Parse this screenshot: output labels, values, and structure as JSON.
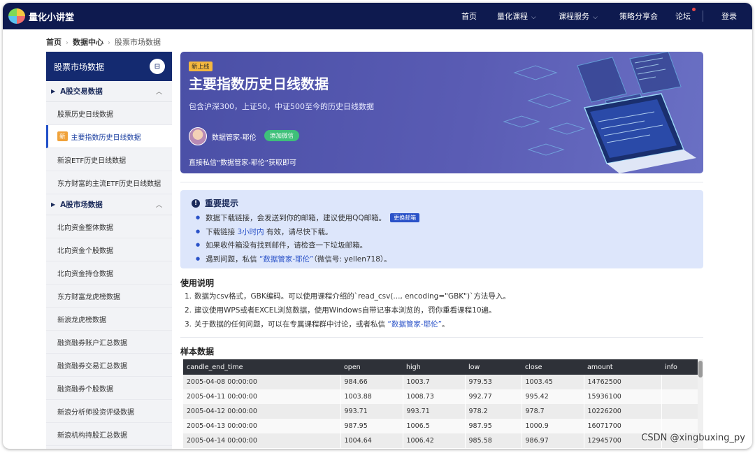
{
  "header": {
    "brand": "量化小讲堂",
    "nav": [
      {
        "label": "首页",
        "dropdown": false
      },
      {
        "label": "量化课程",
        "dropdown": true
      },
      {
        "label": "课程服务",
        "dropdown": true
      },
      {
        "label": "策略分享会",
        "dropdown": false
      },
      {
        "label": "论坛",
        "dropdown": false
      }
    ],
    "login": "登录"
  },
  "breadcrumb": [
    "首页",
    "数据中心",
    "股票市场数据"
  ],
  "sidebar": {
    "title": "股票市场数据",
    "groups": [
      {
        "label": "A股交易数据",
        "items": [
          {
            "label": "股票历史日线数据",
            "active": false,
            "new": false
          },
          {
            "label": "主要指数历史日线数据",
            "active": true,
            "new": true,
            "new_label": "新"
          },
          {
            "label": "新浪ETF历史日线数据",
            "active": false,
            "new": false
          },
          {
            "label": "东方财富的主流ETF历史日线数据",
            "active": false,
            "new": false
          }
        ]
      },
      {
        "label": "A股市场数据",
        "items": [
          {
            "label": "北向资金整体数据"
          },
          {
            "label": "北向资金个股数据"
          },
          {
            "label": "北向资金持仓数据"
          },
          {
            "label": "东方财富龙虎榜数据"
          },
          {
            "label": "新浪龙虎榜数据"
          },
          {
            "label": "融资融券账户汇总数据"
          },
          {
            "label": "融资融券交易汇总数据"
          },
          {
            "label": "融资融券个股数据"
          },
          {
            "label": "新浪分析师投资评级数据"
          },
          {
            "label": "新浪机构持股汇总数据"
          }
        ]
      }
    ]
  },
  "banner": {
    "tag": "新上线",
    "title": "主要指数历史日线数据",
    "subtitle": "包含沪深300，上证50，中证500至今的历史日线数据",
    "author": "数据管家-耶伦",
    "wechat_button": "添加微信",
    "contact": "直接私信“数据管家-耶伦”获取即可"
  },
  "notice": {
    "title": "重要提示",
    "items": [
      {
        "pre": "数据下载链接，会发送到你的邮箱，建议使用QQ邮箱。",
        "button": "更换邮箱"
      },
      {
        "pre": "下载链接 ",
        "highlight": "3小时内",
        "post": " 有效，请尽快下载。"
      },
      {
        "pre": "如果收件箱没有找到邮件，请检查一下垃圾邮箱。"
      },
      {
        "pre": "遇到问题，私信 ",
        "highlight": "“数据管家-耶伦”",
        "post": "（微信号: yellen718）。"
      }
    ]
  },
  "usage": {
    "title": "使用说明",
    "items": [
      {
        "num": "1.",
        "text": "数据为csv格式，GBK编码。可以使用课程介绍的`read_csv(..., encoding=\"GBK\")`方法导入。"
      },
      {
        "num": "2.",
        "text": "建议使用WPS或者EXCEL浏览数据，使用Windows自带记事本浏览的，罚你重看课程10遍。"
      },
      {
        "num": "3.",
        "text": "关于数据的任何问题，可以在专属课程群中讨论，或者私信 ",
        "highlight": "“数据管家-耶伦”",
        "post": "。"
      }
    ]
  },
  "sample": {
    "title": "样本数据",
    "columns": [
      "candle_end_time",
      "open",
      "high",
      "low",
      "close",
      "amount",
      "info"
    ],
    "rows": [
      [
        "2005-04-08 00:00:00",
        "984.66",
        "1003.7",
        "979.53",
        "1003.45",
        "14762500",
        ""
      ],
      [
        "2005-04-11 00:00:00",
        "1003.88",
        "1008.73",
        "992.77",
        "995.42",
        "15936100",
        ""
      ],
      [
        "2005-04-12 00:00:00",
        "993.71",
        "993.71",
        "978.2",
        "978.7",
        "10226200",
        ""
      ],
      [
        "2005-04-13 00:00:00",
        "987.95",
        "1006.5",
        "987.95",
        "1000.9",
        "16071700",
        ""
      ],
      [
        "2005-04-14 00:00:00",
        "1004.64",
        "1006.42",
        "985.58",
        "986.97",
        "12945700",
        ""
      ]
    ]
  },
  "watermark": "CSDN @xingbuxing_py",
  "colors": {
    "nav_bg": "#0e1a4f",
    "sidebar_head": "#142a70",
    "accent": "#2a52c8",
    "banner": "#4a4fa6",
    "new_tag": "#f5b83e",
    "wechat": "#3ec07a"
  }
}
